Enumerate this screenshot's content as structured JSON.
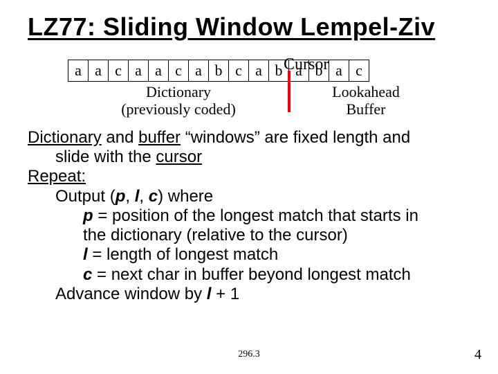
{
  "title": "LZ77: Sliding Window Lempel-Ziv",
  "diagram": {
    "cursor_label": "Cursor",
    "cells": [
      "a",
      "a",
      "c",
      "a",
      "a",
      "c",
      "a",
      "b",
      "c",
      "a",
      "b",
      "a",
      "b",
      "a",
      "c"
    ],
    "dict_label_line1": "Dictionary",
    "dict_label_line2": "(previously coded)",
    "look_label_line1": "Lookahead",
    "look_label_line2": "Buffer"
  },
  "body": {
    "l1a": "Dictionary",
    "l1b": " and ",
    "l1c": "buffer",
    "l1d": " “windows” are fixed length and",
    "l2": "slide with the ",
    "l2u": "cursor",
    "l3": "Repeat:",
    "l4a": "Output (",
    "l4p": "p",
    "l4b": ", ",
    "l4l": "l",
    "l4c": ", ",
    "l4cc": "c",
    "l4d": ") where",
    "l5p": "p",
    "l5": " = position of the longest match that starts in",
    "l6": "the dictionary (relative to the cursor)",
    "l7l": "l",
    "l7": " = length of longest match",
    "l8c": "c",
    "l8": " = next char in buffer beyond longest match",
    "l9a": "Advance window by ",
    "l9l": "l",
    "l9b": " + 1"
  },
  "footer": {
    "center": "296.3",
    "page": "4"
  }
}
